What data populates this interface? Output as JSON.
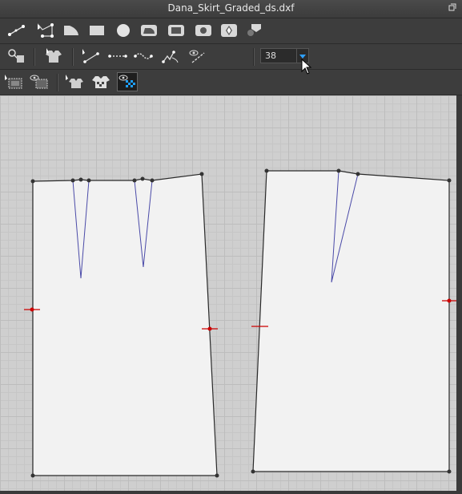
{
  "window": {
    "title": "Dana_Skirt_Graded_ds.dxf"
  },
  "toolbar_row1": [
    {
      "name": "line-tool-icon"
    },
    {
      "name": "polyline-tool-icon"
    },
    {
      "name": "curve-shape-tool-icon"
    },
    {
      "name": "rectangle-tool-icon"
    },
    {
      "name": "circle-tool-icon"
    },
    {
      "name": "rounded-shape-tool-icon"
    },
    {
      "name": "rounded-rect-tool-icon"
    },
    {
      "name": "square-circle-tool-icon"
    },
    {
      "name": "diamond-tool-icon"
    },
    {
      "name": "notch-shape-tool-icon"
    }
  ],
  "toolbar_row2": {
    "size_value": "38",
    "icons": [
      "pin-tool-icon",
      "garment-tool-icon",
      "measure-line-icon",
      "dotted-line-icon",
      "wave-line-icon",
      "dart-tool-icon",
      "view-line-icon"
    ]
  },
  "toolbar_row3": {
    "icons": [
      "select-grid-icon",
      "view-grid-icon",
      "select-garment-icon",
      "fabric-icon",
      "view-fabric-icon"
    ]
  },
  "canvas": {
    "grid": true,
    "pattern_fill": "#f2f2f2",
    "outline_color": "#2a2a2a",
    "dart_color": "#4a4aa8",
    "notch_color": "#cc0000"
  }
}
